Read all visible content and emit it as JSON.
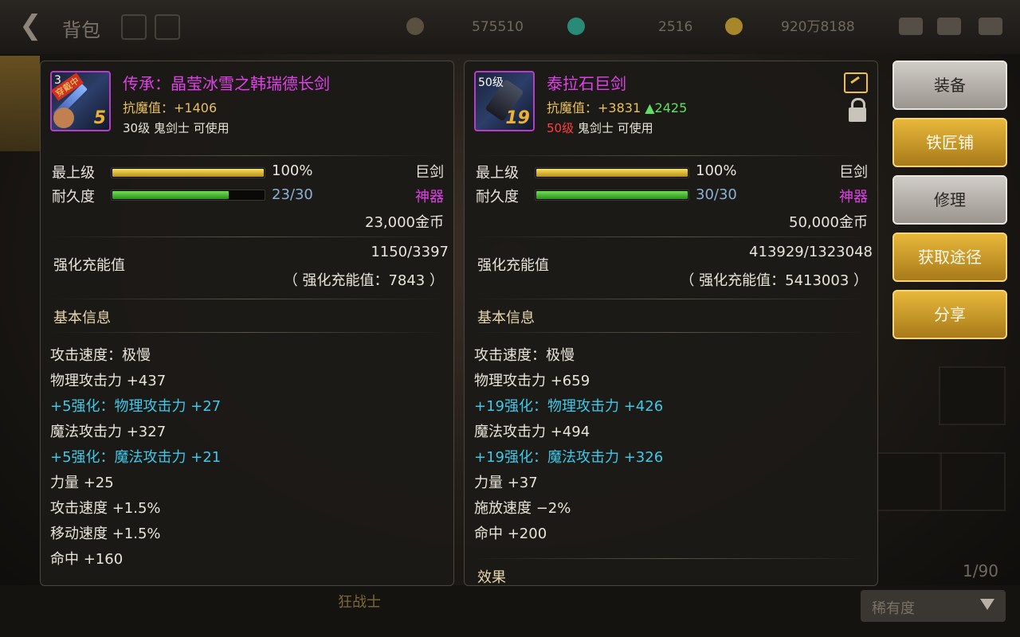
{
  "topbar": {
    "back_label": "背包",
    "currency1": "575510",
    "currency2": "2516",
    "currency3": "920万8188"
  },
  "left_item": {
    "name": "传承：晶莹冰雪之韩瑞德长剑",
    "antimagic": "抗魔值：+1406",
    "requirement": "30级 鬼剑士 可使用",
    "icon_level": "5",
    "icon_top_left": "3",
    "equip_tag": "穿戴中",
    "grade_label": "最上级",
    "grade_value": "100%",
    "grade_fill": 1.0,
    "type": "巨剑",
    "durability_label": "耐久度",
    "durability_value": "23/30",
    "durability_fill": 0.767,
    "rarity": "神器",
    "price": "23,000金币",
    "charge_label": "强化充能值",
    "charge_value": "1150/3397",
    "charge_total": "（ 强化充能值：7843 ）",
    "basic_info_label": "基本信息",
    "lines": [
      {
        "text": "攻击速度：极慢",
        "color": "#e8e4dc"
      },
      {
        "text": "物理攻击力 +437",
        "color": "#e8e4dc"
      },
      {
        "text": "+5强化：物理攻击力 +27",
        "color": "#40c8e8"
      },
      {
        "text": "魔法攻击力 +327",
        "color": "#e8e4dc"
      },
      {
        "text": "+5强化：魔法攻击力 +21",
        "color": "#40c8e8"
      },
      {
        "text": "力量 +25",
        "color": "#e8e4dc"
      },
      {
        "text": "攻击速度 +1.5%",
        "color": "#e8e4dc"
      },
      {
        "text": "移动速度 +1.5%",
        "color": "#e8e4dc"
      },
      {
        "text": "命中 +160",
        "color": "#e8e4dc"
      }
    ]
  },
  "right_item": {
    "name": "泰拉石巨剑",
    "antimagic_prefix": "抗魔值：+3831",
    "antimagic_up": "▲2425",
    "req_level": "50级",
    "requirement": " 鬼剑士 可使用",
    "icon_level": "19",
    "icon_top_left": "50级",
    "grade_label": "最上级",
    "grade_value": "100%",
    "grade_fill": 1.0,
    "type": "巨剑",
    "durability_label": "耐久度",
    "durability_value": "30/30",
    "durability_fill": 1.0,
    "rarity": "神器",
    "price": "50,000金币",
    "charge_label": "强化充能值",
    "charge_value": "413929/1323048",
    "charge_total": "（ 强化充能值：5413003 ）",
    "basic_info_label": "基本信息",
    "lines": [
      {
        "text": "攻击速度：极慢",
        "color": "#e8e4dc"
      },
      {
        "text": "物理攻击力 +659",
        "color": "#e8e4dc"
      },
      {
        "text": "+19强化：物理攻击力 +426",
        "color": "#40c8e8"
      },
      {
        "text": "魔法攻击力 +494",
        "color": "#e8e4dc"
      },
      {
        "text": "+19强化：魔法攻击力 +326",
        "color": "#40c8e8"
      },
      {
        "text": "力量 +37",
        "color": "#e8e4dc"
      },
      {
        "text": "施放速度 −2%",
        "color": "#e8e4dc"
      },
      {
        "text": "命中 +200",
        "color": "#e8e4dc"
      }
    ],
    "cut_label": "效果"
  },
  "side_buttons": [
    "装备",
    "铁匠铺",
    "修理",
    "获取途径",
    "分享"
  ],
  "bottom": {
    "count": "1/90",
    "sort": "稀有度",
    "class_label": "狂战士"
  }
}
